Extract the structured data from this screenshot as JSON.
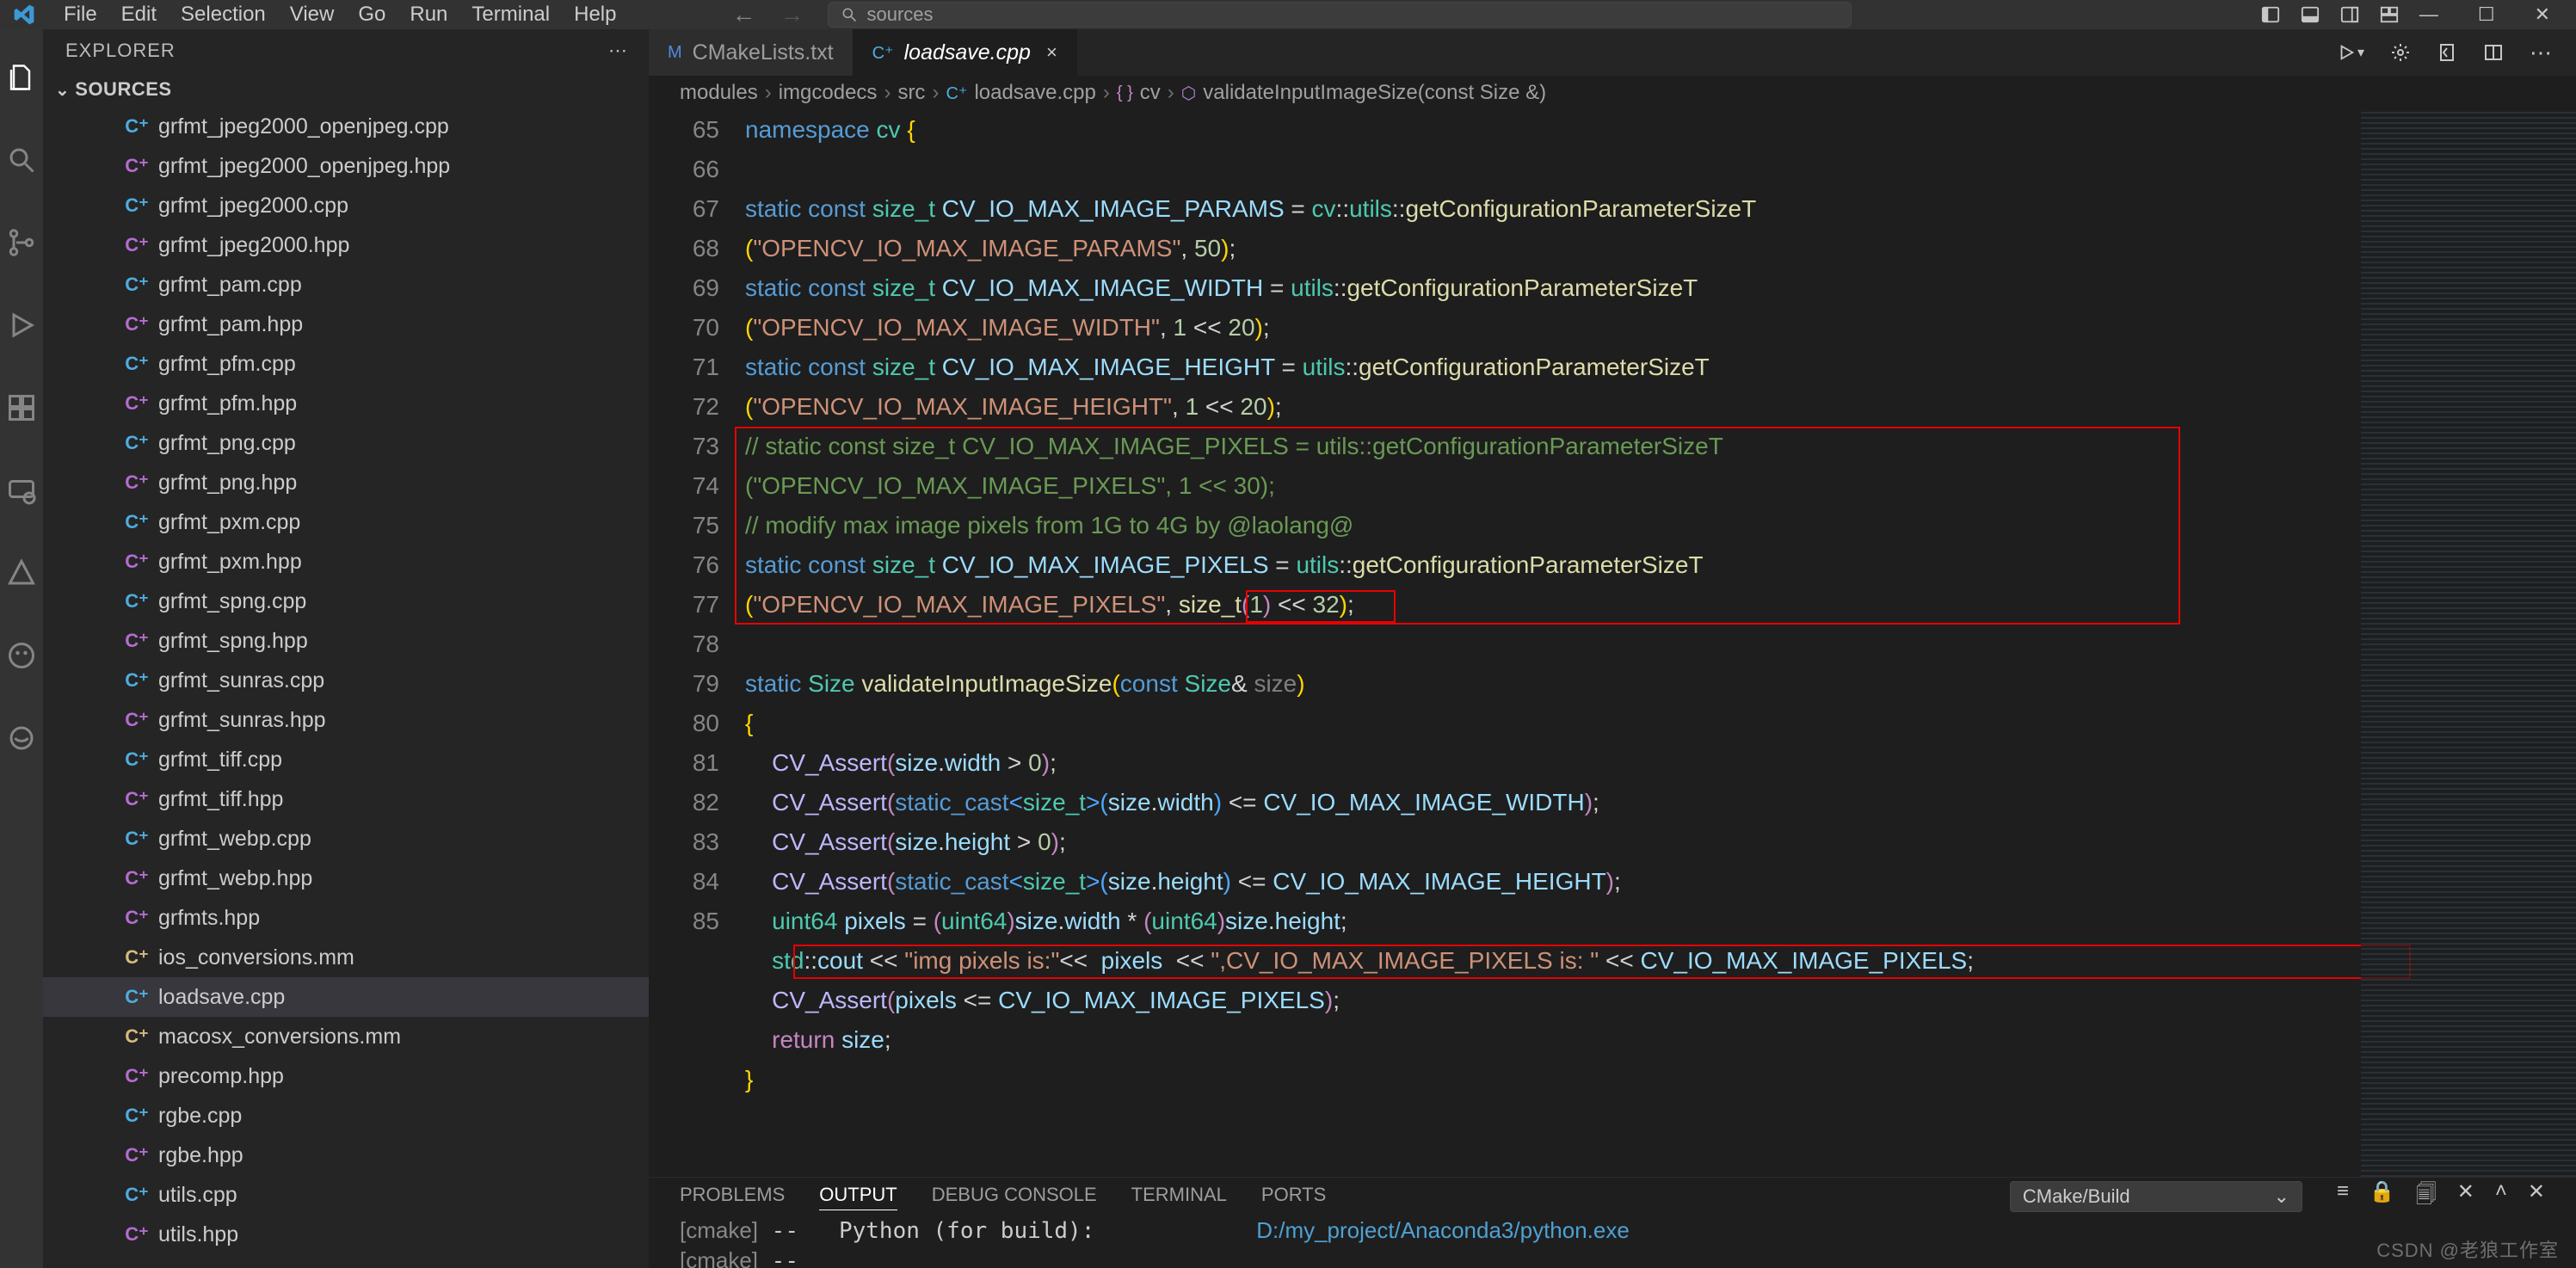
{
  "menu": {
    "items": [
      "File",
      "Edit",
      "Selection",
      "View",
      "Go",
      "Run",
      "Terminal",
      "Help"
    ]
  },
  "search": {
    "placeholder": "sources"
  },
  "explorer": {
    "title": "EXPLORER",
    "section": "SOURCES",
    "files": [
      {
        "icon": "cpp",
        "name": "grfmt_jpeg2000_openjpeg.cpp"
      },
      {
        "icon": "hpp",
        "name": "grfmt_jpeg2000_openjpeg.hpp"
      },
      {
        "icon": "cpp",
        "name": "grfmt_jpeg2000.cpp"
      },
      {
        "icon": "hpp",
        "name": "grfmt_jpeg2000.hpp"
      },
      {
        "icon": "cpp",
        "name": "grfmt_pam.cpp"
      },
      {
        "icon": "hpp",
        "name": "grfmt_pam.hpp"
      },
      {
        "icon": "cpp",
        "name": "grfmt_pfm.cpp"
      },
      {
        "icon": "hpp",
        "name": "grfmt_pfm.hpp"
      },
      {
        "icon": "cpp",
        "name": "grfmt_png.cpp"
      },
      {
        "icon": "hpp",
        "name": "grfmt_png.hpp"
      },
      {
        "icon": "cpp",
        "name": "grfmt_pxm.cpp"
      },
      {
        "icon": "hpp",
        "name": "grfmt_pxm.hpp"
      },
      {
        "icon": "cpp",
        "name": "grfmt_spng.cpp"
      },
      {
        "icon": "hpp",
        "name": "grfmt_spng.hpp"
      },
      {
        "icon": "cpp",
        "name": "grfmt_sunras.cpp"
      },
      {
        "icon": "hpp",
        "name": "grfmt_sunras.hpp"
      },
      {
        "icon": "cpp",
        "name": "grfmt_tiff.cpp"
      },
      {
        "icon": "hpp",
        "name": "grfmt_tiff.hpp"
      },
      {
        "icon": "cpp",
        "name": "grfmt_webp.cpp"
      },
      {
        "icon": "hpp",
        "name": "grfmt_webp.hpp"
      },
      {
        "icon": "hpp",
        "name": "grfmts.hpp"
      },
      {
        "icon": "mm",
        "name": "ios_conversions.mm"
      },
      {
        "icon": "cpp",
        "name": "loadsave.cpp",
        "selected": true
      },
      {
        "icon": "mm",
        "name": "macosx_conversions.mm"
      },
      {
        "icon": "hpp",
        "name": "precomp.hpp"
      },
      {
        "icon": "cpp",
        "name": "rgbe.cpp"
      },
      {
        "icon": "hpp",
        "name": "rgbe.hpp"
      },
      {
        "icon": "cpp",
        "name": "utils.cpp"
      },
      {
        "icon": "hpp",
        "name": "utils.hpp"
      }
    ]
  },
  "tabs": [
    {
      "icon": "M",
      "iconColor": "#4e8be0",
      "label": "CMakeLists.txt",
      "active": false
    },
    {
      "icon": "C⁺",
      "iconColor": "#4eade0",
      "label": "loadsave.cpp",
      "active": true,
      "closeable": true
    }
  ],
  "breadcrumbs": [
    "modules",
    "imgcodecs",
    "src",
    "loadsave.cpp",
    "cv",
    "validateInputImageSize(const Size &)"
  ],
  "line_numbers": [
    "65",
    "66",
    "67",
    "",
    "68",
    "",
    "69",
    "",
    "70",
    "",
    "71",
    "72",
    "",
    "73",
    "74",
    "75",
    "76",
    "77",
    "78",
    "79",
    "80",
    "81",
    "82",
    "83",
    "84",
    "85"
  ],
  "code_plain": [
    "namespace cv {",
    "",
    "static const size_t CV_IO_MAX_IMAGE_PARAMS = cv::utils::getConfigurationParameterSizeT",
    "(\"OPENCV_IO_MAX_IMAGE_PARAMS\", 50);",
    "static const size_t CV_IO_MAX_IMAGE_WIDTH = utils::getConfigurationParameterSizeT",
    "(\"OPENCV_IO_MAX_IMAGE_WIDTH\", 1 << 20);",
    "static const size_t CV_IO_MAX_IMAGE_HEIGHT = utils::getConfigurationParameterSizeT",
    "(\"OPENCV_IO_MAX_IMAGE_HEIGHT\", 1 << 20);",
    "// static const size_t CV_IO_MAX_IMAGE_PIXELS = utils::getConfigurationParameterSizeT",
    "(\"OPENCV_IO_MAX_IMAGE_PIXELS\", 1 << 30);",
    "// modify max image pixels from 1G to 4G by @laolang@",
    "static const size_t CV_IO_MAX_IMAGE_PIXELS = utils::getConfigurationParameterSizeT",
    "(\"OPENCV_IO_MAX_IMAGE_PIXELS\", size_t(1) << 32);",
    "",
    "static Size validateInputImageSize(const Size& size)",
    "{",
    "    CV_Assert(size.width > 0);",
    "    CV_Assert(static_cast<size_t>(size.width) <= CV_IO_MAX_IMAGE_WIDTH);",
    "    CV_Assert(size.height > 0);",
    "    CV_Assert(static_cast<size_t>(size.height) <= CV_IO_MAX_IMAGE_HEIGHT);",
    "    uint64 pixels = (uint64)size.width * (uint64)size.height;",
    "    std::cout << \"img pixels is:\"<<  pixels  << \",CV_IO_MAX_IMAGE_PIXELS is: \" << CV_IO_MAX_IMAGE_PIXELS;",
    "    CV_Assert(pixels <= CV_IO_MAX_IMAGE_PIXELS);",
    "    return size;",
    "}",
    ""
  ],
  "panel": {
    "tabs": [
      "PROBLEMS",
      "OUTPUT",
      "DEBUG CONSOLE",
      "TERMINAL",
      "PORTS"
    ],
    "active_tab": "OUTPUT",
    "task_picker": "CMake/Build",
    "output_lines": [
      "[cmake] --   Python (for build):            D:/my_project/Anaconda3/python.exe",
      "[cmake] -- "
    ]
  },
  "watermark": "CSDN @老狼工作室"
}
